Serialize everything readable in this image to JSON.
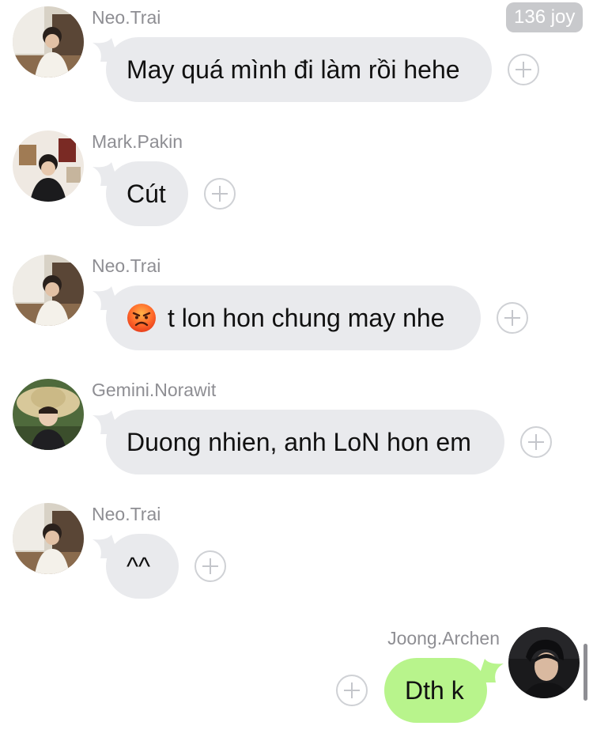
{
  "top_badge": "136 joy",
  "messages": [
    {
      "sender": "Neo.Trai",
      "text": "May quá mình đi làm rồi hehe",
      "emoji": ""
    },
    {
      "sender": "Mark.Pakin",
      "text": "Cút",
      "emoji": ""
    },
    {
      "sender": "Neo.Trai",
      "text": "t lon hon chung may nhe",
      "emoji": "angry-face-icon"
    },
    {
      "sender": "Gemini.Norawit",
      "text": "Duong nhien, anh LoN hon em",
      "emoji": ""
    },
    {
      "sender": "Neo.Trai",
      "text": "^^",
      "emoji": ""
    },
    {
      "sender": "Joong.Archen",
      "text": "Dth k",
      "emoji": "",
      "outgoing": true
    }
  ],
  "colors": {
    "incoming_bubble": "#e9eaed",
    "outgoing_bubble": "#b8f48c",
    "sender_name": "#8e8e93"
  }
}
